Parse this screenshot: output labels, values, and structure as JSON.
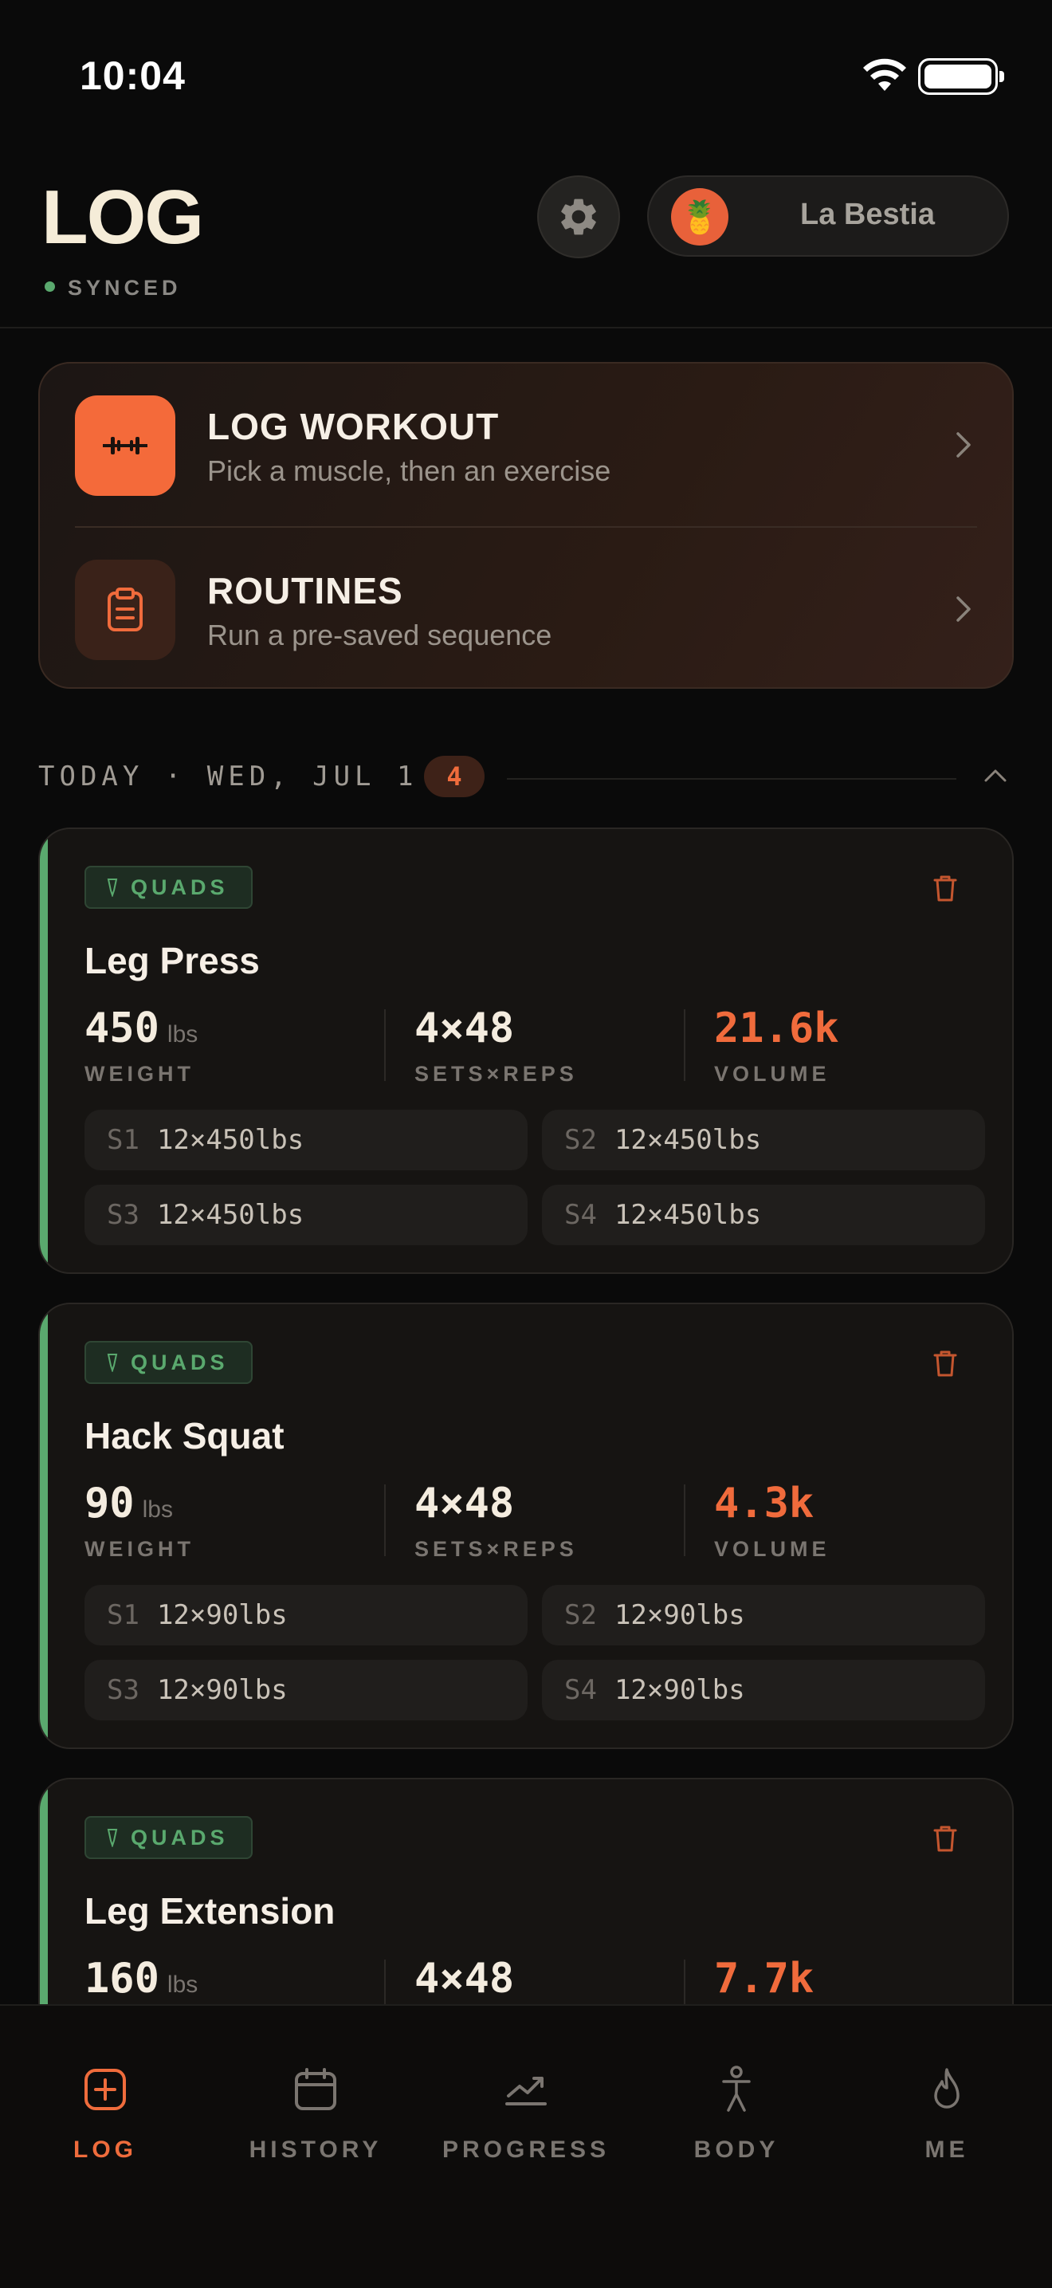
{
  "status_bar": {
    "time": "10:04"
  },
  "header": {
    "title": "LOG",
    "sync_status": "SYNCED",
    "profile_name": "La Bestia",
    "avatar_icon": "pineapple-icon",
    "settings_icon": "gear-icon"
  },
  "actions": [
    {
      "title": "LOG WORKOUT",
      "subtitle": "Pick a muscle, then an exercise",
      "icon": "barbell-icon"
    },
    {
      "title": "ROUTINES",
      "subtitle": "Run a pre-saved sequence",
      "icon": "clipboard-icon"
    }
  ],
  "section": {
    "label": "TODAY · WED, JUL 1",
    "count": "4"
  },
  "exercises": [
    {
      "tag": "QUADS",
      "name": "Leg Press",
      "weight": "450",
      "weight_unit": "lbs",
      "weight_label": "WEIGHT",
      "sets_reps": "4×48",
      "sets_reps_label": "SETS×REPS",
      "volume": "21.6k",
      "volume_label": "VOLUME",
      "sets": [
        {
          "id": "S1",
          "value": "12×450lbs"
        },
        {
          "id": "S2",
          "value": "12×450lbs"
        },
        {
          "id": "S3",
          "value": "12×450lbs"
        },
        {
          "id": "S4",
          "value": "12×450lbs"
        }
      ]
    },
    {
      "tag": "QUADS",
      "name": "Hack Squat",
      "weight": "90",
      "weight_unit": "lbs",
      "weight_label": "WEIGHT",
      "sets_reps": "4×48",
      "sets_reps_label": "SETS×REPS",
      "volume": "4.3k",
      "volume_label": "VOLUME",
      "sets": [
        {
          "id": "S1",
          "value": "12×90lbs"
        },
        {
          "id": "S2",
          "value": "12×90lbs"
        },
        {
          "id": "S3",
          "value": "12×90lbs"
        },
        {
          "id": "S4",
          "value": "12×90lbs"
        }
      ]
    },
    {
      "tag": "QUADS",
      "name": "Leg Extension",
      "weight": "160",
      "weight_unit": "lbs",
      "sets_reps": "4×48",
      "volume": "7.7k"
    }
  ],
  "tabs": [
    {
      "label": "LOG",
      "icon": "plus-square-icon",
      "active": true
    },
    {
      "label": "HISTORY",
      "icon": "calendar-icon",
      "active": false
    },
    {
      "label": "PROGRESS",
      "icon": "trend-chart-icon",
      "active": false
    },
    {
      "label": "BODY",
      "icon": "person-icon",
      "active": false
    },
    {
      "label": "ME",
      "icon": "flame-icon",
      "active": false
    }
  ],
  "colors": {
    "accent": "#ef6c3c",
    "muscle_quads": "#5aa96e",
    "background": "#0a0a0a"
  }
}
